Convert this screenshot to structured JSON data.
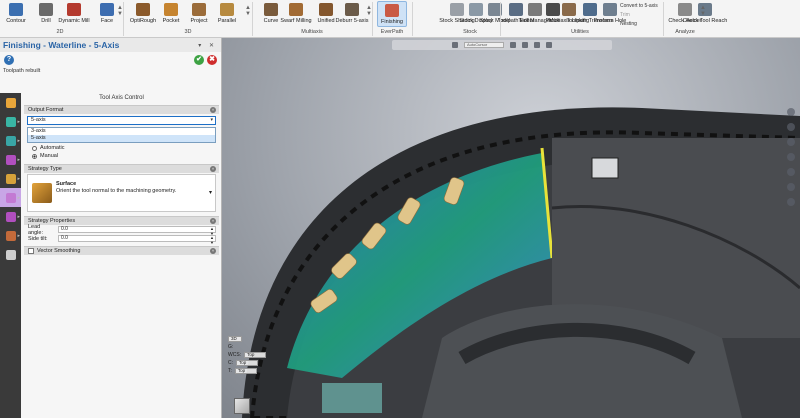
{
  "ribbon": {
    "groups": [
      {
        "label": "2D"
      },
      {
        "label": "3D"
      },
      {
        "label": "Multiaxis"
      },
      {
        "label": "EverPath"
      },
      {
        "label": "Stock"
      },
      {
        "label": "Utilities"
      },
      {
        "label": "Analyze"
      }
    ],
    "buttons": [
      {
        "label": "Contour",
        "color": "#3c6fb0"
      },
      {
        "label": "Drill",
        "color": "#6a6a6a"
      },
      {
        "label": "Dynamic Mill",
        "color": "#b43a2e"
      },
      {
        "label": "Face",
        "color": "#3d6db0"
      },
      {
        "label": "OptiRough",
        "color": "#8b5a2b"
      },
      {
        "label": "Pocket",
        "color": "#c6842f"
      },
      {
        "label": "Project",
        "color": "#9b6c3a"
      },
      {
        "label": "Parallel",
        "color": "#b78a3f"
      },
      {
        "label": "Curve",
        "color": "#7a5b3c"
      },
      {
        "label": "Swarf Milling",
        "color": "#a26b34"
      },
      {
        "label": "Unified",
        "color": "#84572e"
      },
      {
        "label": "Deburr 5-axis",
        "color": "#6b5b49"
      },
      {
        "label": "Finishing",
        "color": "#c95a45"
      },
      {
        "label": "Stock Shading",
        "color": "#9aa0a7"
      },
      {
        "label": "Stock Display",
        "color": "#8b99a6"
      },
      {
        "label": "Stock Model",
        "color": "#7b8793"
      },
      {
        "label": "Toolpath Editor",
        "color": "#5a6d84"
      },
      {
        "label": "Tool Manager",
        "color": "#7a7a7a"
      },
      {
        "label": "Probe",
        "color": "#4a4a4a"
      },
      {
        "label": "Multiaxis Linking",
        "color": "#8a6a4a"
      },
      {
        "label": "Toolpath Transform",
        "color": "#4f6c8c"
      },
      {
        "label": "Process Hole",
        "color": "#6f7f8f"
      },
      {
        "label": "Check Holder",
        "color": "#8a8a8a"
      },
      {
        "label": "Check Tool Reach",
        "color": "#6a7a8a"
      }
    ],
    "utility_links": [
      "Convert to 5-axis",
      "Trim",
      "Nesting"
    ]
  },
  "side_panel": {
    "title": "Finishing - Waterline - 5-Axis",
    "window_controls": "▾ ✕",
    "subtitle": "Toolpath rebuilt",
    "help_glyph": "?",
    "ok_glyph": "✔",
    "cancel_glyph": "✖",
    "pane_title": "Tool Axis Control",
    "nav_colors": [
      "#e9a63a",
      "#39b6a5",
      "#39a6a6",
      "#b14fbf",
      "#d6a23a",
      "#c37ad3",
      "#b14fbf",
      "#c36a3a",
      "#cfcfcf"
    ],
    "output_format": {
      "header": "Output Format",
      "selected": "5-axis",
      "options": [
        "3-axis",
        "5-axis"
      ]
    },
    "radios": [
      {
        "label": "Automatic",
        "checked": false
      },
      {
        "label": "Manual",
        "checked": true
      }
    ],
    "strategy_type": {
      "header": "Strategy Type",
      "name": "Surface",
      "description": "Orient the tool normal to the machining geometry."
    },
    "strategy_properties": {
      "header": "Strategy Properties",
      "lead_label": "Lead angle:",
      "lead_value": "0.0",
      "side_label": "Side tilt:",
      "side_value": "0.0"
    },
    "vector_smoothing": {
      "label": "Vector Smoothing",
      "checked": false
    }
  },
  "viewport": {
    "search_placeholder": "AutoCursor",
    "wcs": [
      {
        "label": "G:",
        "value": ""
      },
      {
        "label": "WCS:",
        "value": "Top"
      },
      {
        "label": "C:",
        "value": "Top"
      },
      {
        "label": "T:",
        "value": "Top"
      }
    ],
    "view_label": "3D"
  }
}
